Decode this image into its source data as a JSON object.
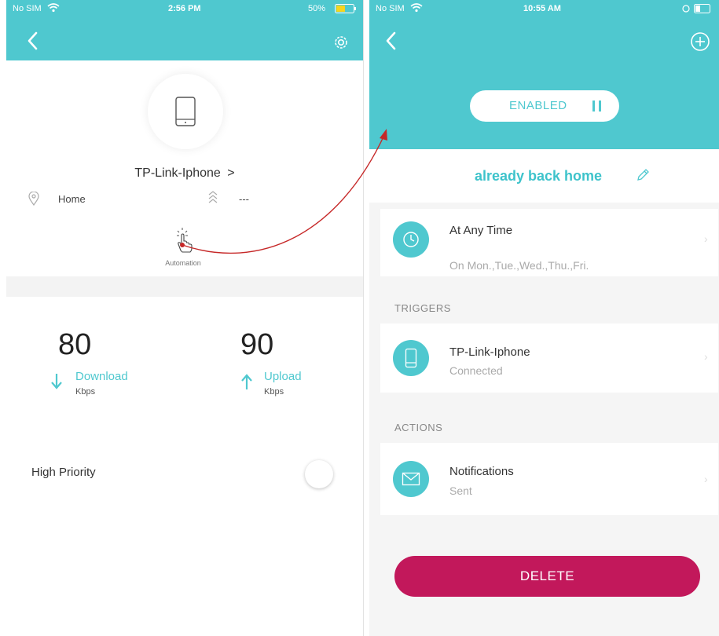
{
  "left_screen": {
    "status": {
      "carrier": "No SIM",
      "time": "2:56 PM",
      "battery": "50%"
    },
    "device_name": "TP-Link-Iphone",
    "device_chevron": ">",
    "location": "Home",
    "signal_value": "---",
    "automation_label": "Automation",
    "download": {
      "value": "80",
      "label": "Download",
      "unit": "Kbps"
    },
    "upload": {
      "value": "90",
      "label": "Upload",
      "unit": "Kbps"
    },
    "high_priority": {
      "label": "High Priority",
      "enabled": false
    }
  },
  "right_screen": {
    "status": {
      "carrier": "No SIM",
      "time": "10:55 AM"
    },
    "toggle_label": "ENABLED",
    "automation_name": "already back home",
    "schedule": {
      "title": "At Any Time",
      "days": "On Mon.,Tue.,Wed.,Thu.,Fri."
    },
    "triggers_heading": "TRIGGERS",
    "trigger": {
      "title": "TP-Link-Iphone",
      "status": "Connected"
    },
    "actions_heading": "ACTIONS",
    "action": {
      "title": "Notifications",
      "status": "Sent"
    },
    "delete_label": "DELETE"
  },
  "colors": {
    "accent": "#4fc8cf",
    "delete": "#c2185b",
    "annotation_arrow": "#c62828"
  },
  "icons": [
    "wifi-icon",
    "battery-icon",
    "back-arrow-icon",
    "gear-icon",
    "phone-icon",
    "location-pin-icon",
    "signal-icon",
    "tap-hand-icon",
    "down-arrow-icon",
    "up-arrow-icon",
    "add-circle-icon",
    "pause-icon",
    "pencil-icon",
    "clock-icon",
    "envelope-icon",
    "chevron-right-icon"
  ]
}
